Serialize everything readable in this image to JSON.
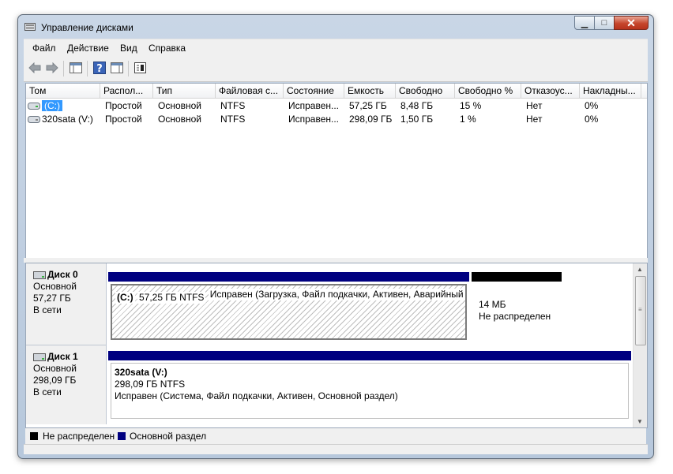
{
  "window": {
    "title": "Управление дисками",
    "buttons": {
      "minimize": "▁",
      "maximize": "□",
      "close": "✕"
    }
  },
  "menu": [
    "Файл",
    "Действие",
    "Вид",
    "Справка"
  ],
  "toolbar": {
    "buttons": [
      "back-icon",
      "forward-icon",
      "console-tree-icon",
      "help-icon",
      "show-hide-icon",
      "properties-icon"
    ]
  },
  "volume_list": {
    "columns": [
      "Том",
      "Распол...",
      "Тип",
      "Файловая с...",
      "Состояние",
      "Емкость",
      "Свободно",
      "Свободно %",
      "Отказоус...",
      "Накладны..."
    ],
    "rows": [
      {
        "name": "(C:)",
        "layout": "Простой",
        "type": "Основной",
        "fs": "NTFS",
        "status": "Исправен...",
        "capacity": "57,25 ГБ",
        "free": "8,48 ГБ",
        "free_pct": "15 %",
        "fault": "Нет",
        "overhead": "0%",
        "selected": true
      },
      {
        "name": "320sata (V:)",
        "layout": "Простой",
        "type": "Основной",
        "fs": "NTFS",
        "status": "Исправен...",
        "capacity": "298,09 ГБ",
        "free": "1,50 ГБ",
        "free_pct": "1 %",
        "fault": "Нет",
        "overhead": "0%",
        "selected": false
      }
    ]
  },
  "disks": [
    {
      "name": "Диск 0",
      "type": "Основной",
      "size": "57,27 ГБ",
      "state": "В сети",
      "partitions": [
        {
          "name": "(C:)",
          "size_fs": "57,25 ГБ NTFS",
          "status": "Исправен (Загрузка, Файл подкачки, Активен, Аварийный дамп памяти, Основн",
          "kind": "primary"
        },
        {
          "size_fs": "14 МБ",
          "status": "Не распределен",
          "kind": "unallocated"
        }
      ]
    },
    {
      "name": "Диск 1",
      "type": "Основной",
      "size": "298,09 ГБ",
      "state": "В сети",
      "partitions": [
        {
          "name": "320sata  (V:)",
          "size_fs": "298,09 ГБ NTFS",
          "status": "Исправен (Система, Файл подкачки, Активен, Основной раздел)",
          "kind": "primary"
        }
      ]
    }
  ],
  "legend": [
    {
      "label": "Не распределен",
      "color": "#000000"
    },
    {
      "label": "Основной раздел",
      "color": "#000080"
    }
  ],
  "colors": {
    "primary_bar": "#000080",
    "unallocated_bar": "#000000",
    "selection": "#3399ff"
  }
}
